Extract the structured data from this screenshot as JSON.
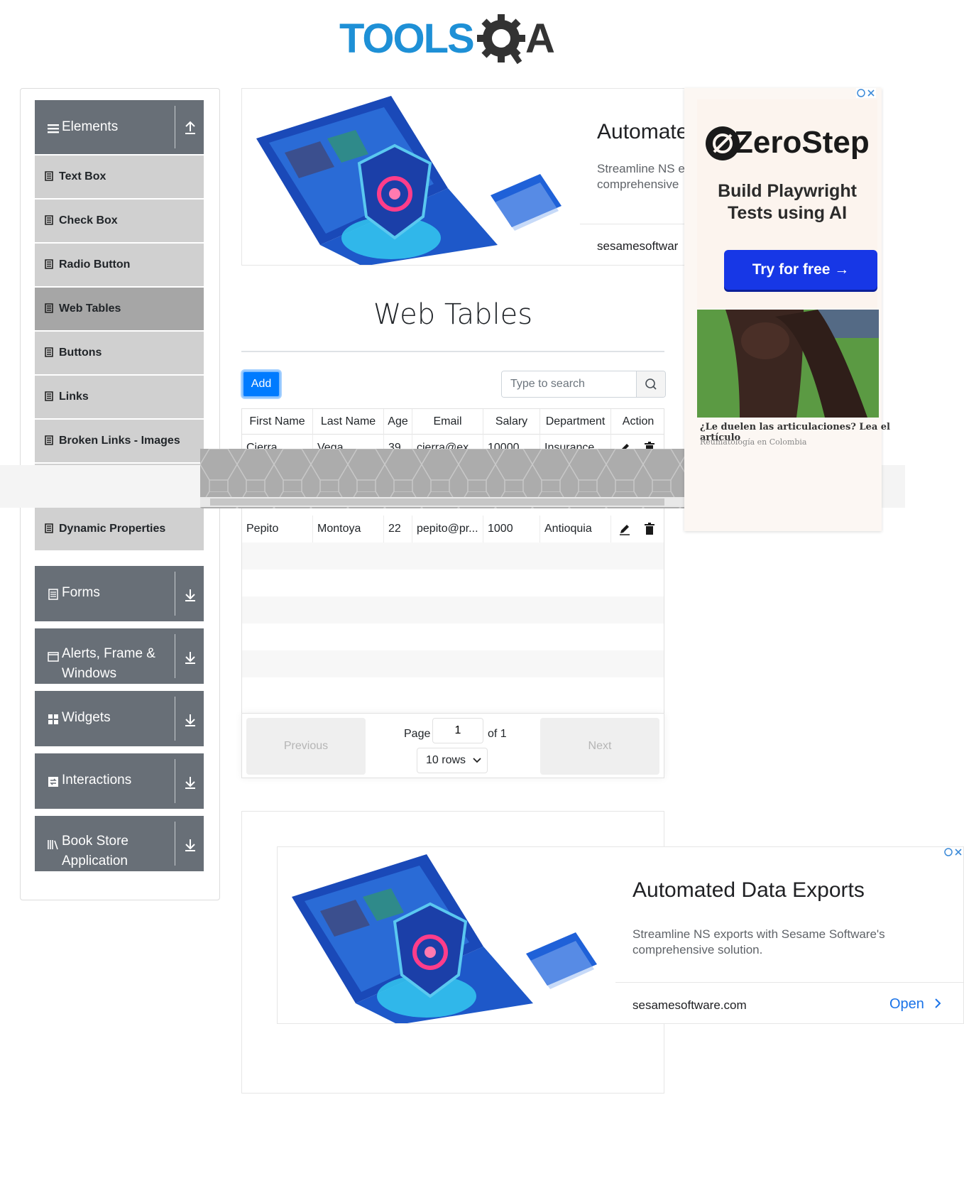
{
  "logo": {
    "text": "TOOLSQA"
  },
  "sidebar": {
    "groups": [
      {
        "label": "Elements",
        "icon": "hamburger-icon",
        "arrow": "upload-arrow-icon"
      },
      {
        "label": "Forms",
        "icon": "form-icon",
        "arrow": "download-arrow-icon"
      },
      {
        "label": "Alerts, Frame & Windows",
        "icon": "window-icon",
        "arrow": "download-arrow-icon"
      },
      {
        "label": "Widgets",
        "icon": "widgets-icon",
        "arrow": "download-arrow-icon"
      },
      {
        "label": "Interactions",
        "icon": "interactions-icon",
        "arrow": "download-arrow-icon"
      },
      {
        "label": "Book Store Application",
        "icon": "books-icon",
        "arrow": "download-arrow-icon"
      }
    ],
    "items": [
      {
        "label": "Text Box",
        "active": false
      },
      {
        "label": "Check Box",
        "active": false
      },
      {
        "label": "Radio Button",
        "active": false
      },
      {
        "label": "Web Tables",
        "active": true
      },
      {
        "label": "Buttons",
        "active": false
      },
      {
        "label": "Links",
        "active": false
      },
      {
        "label": "Broken Links - Images",
        "active": false
      },
      {
        "label": "Dynamic Properties",
        "active": false
      }
    ]
  },
  "top_ad": {
    "title": "Automate",
    "desc_line1": "Streamline NS e",
    "desc_line2": "comprehensive",
    "domain": "sesamesoftwar"
  },
  "main": {
    "page_title": "Web Tables",
    "add_label": "Add",
    "search_placeholder": "Type to search"
  },
  "table": {
    "columns": [
      "First Name",
      "Last Name",
      "Age",
      "Email",
      "Salary",
      "Department",
      "Action"
    ],
    "rows": [
      {
        "first": "Cierra",
        "last": "Vega",
        "age": "39",
        "email": "cierra@ex...",
        "salary": "10000",
        "dept": "Insurance"
      },
      {
        "first": "Pepito",
        "last": "Montoya",
        "age": "22",
        "email": "pepito@pr...",
        "salary": "1000",
        "dept": "Antioquia"
      }
    ]
  },
  "pagination": {
    "previous_label": "Previous",
    "next_label": "Next",
    "page_label": "Page",
    "page_value": "1",
    "of_label": "of 1",
    "rows_label": "10 rows"
  },
  "side_ad": {
    "brand": "ZeroStep",
    "headline_line1": "Build Playwright",
    "headline_line2": "Tests using AI",
    "cta": "Try for free →",
    "caption": "¿Le duelen las articulaciones? Lea el artículo",
    "source": "Reumatología en Colombia"
  },
  "bottom_ad": {
    "title": "Automated Data Exports",
    "desc_line1": "Streamline NS exports with Sesame Software's",
    "desc_line2": "comprehensive solution.",
    "domain": "sesamesoftware.com",
    "open_label": "Open"
  },
  "colors": {
    "primary": "#007bff",
    "sidebar_group": "#686f77",
    "sidebar_item": "#d0d0d0",
    "sidebar_active": "#a6a6a6",
    "cta_blue": "#1737e6",
    "logo_blue": "#1e90d6"
  }
}
